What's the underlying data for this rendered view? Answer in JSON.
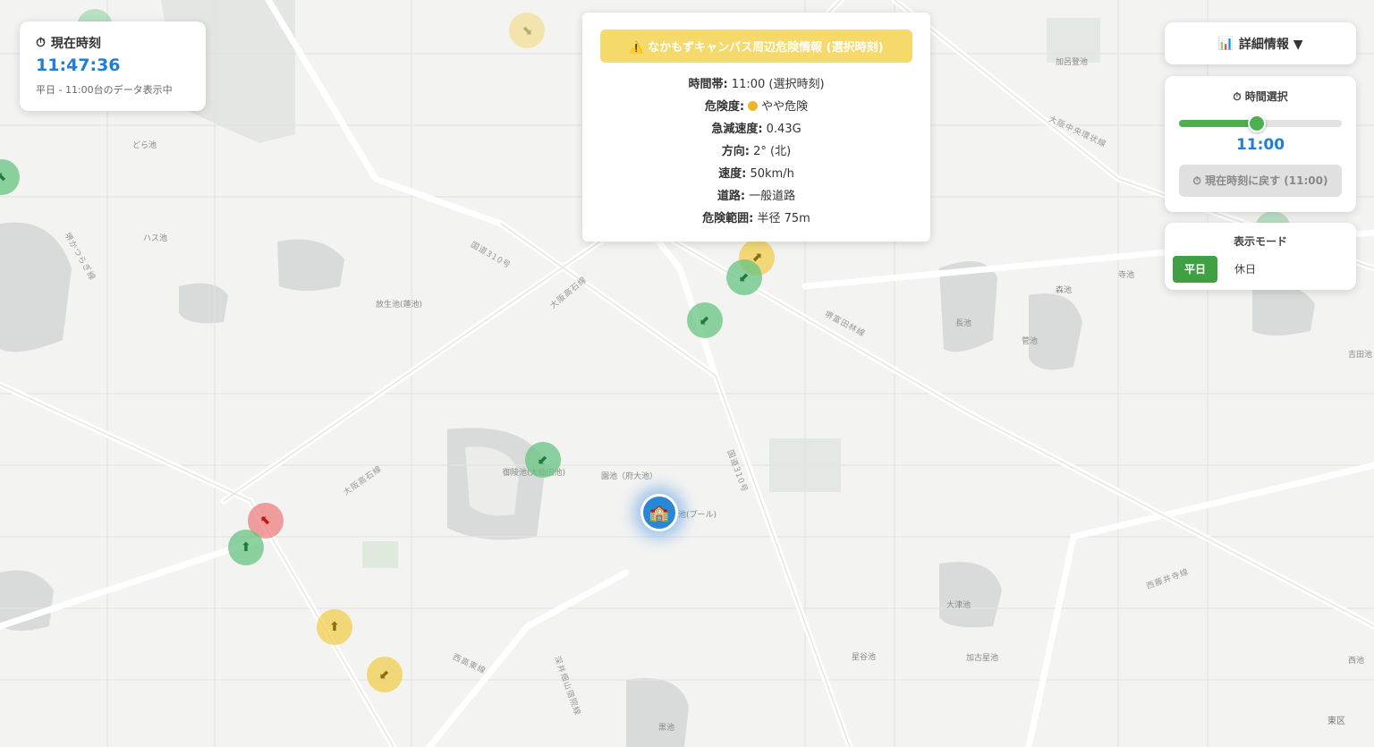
{
  "clock": {
    "icon": "clock-icon",
    "title": "現在時刻",
    "time": "11:47:36",
    "mode_text": "平日 - 11:00台のデータ表示中"
  },
  "popup": {
    "icon": "warning-icon",
    "title": "なかもずキャンパス周辺危険情報 (選択時刻)",
    "rows": [
      {
        "label": "時間帯:",
        "value": "11:00 (選択時刻)"
      },
      {
        "label": "危険度:",
        "value": "やや危険"
      },
      {
        "label": "急減速度:",
        "value": "0.43G"
      },
      {
        "label": "方向:",
        "value": "2° (北)"
      },
      {
        "label": "速度:",
        "value": "50km/h"
      },
      {
        "label": "道路:",
        "value": "一般道路"
      },
      {
        "label": "危険範囲:",
        "value": "半径 75m"
      }
    ],
    "risk_color": "#f0b429"
  },
  "detail": {
    "icon": "bar-chart-icon",
    "label": "詳細情報 ▼"
  },
  "time_select": {
    "icon": "clock-icon",
    "label": "時間選択",
    "value": "11:00",
    "slider_fraction": 0.48,
    "reset_label": "現在時刻に戻す (11:00)"
  },
  "display_mode": {
    "label": "表示モード",
    "options": [
      "平日",
      "休日"
    ],
    "selected": "平日"
  },
  "map_labels": {
    "dora": "どら池",
    "hasu": "ハス池",
    "houshou": "放生池(蓮池)",
    "goryou": "御陵池(大仙田池)",
    "sono": "園池（府大池）",
    "pool": "池(プール)",
    "nagaike": "長池",
    "sugeike": "菅池",
    "moriike": "森池",
    "teraike": "寺池",
    "yoshida": "吉田池",
    "kashiike": "加呂登池",
    "ootsu": "大津池",
    "hoshiya": "星谷池",
    "kako": "加古星池",
    "nishiike": "西池",
    "higashiku": "東区",
    "kuroike": "黒池"
  },
  "road_labels": {
    "kokudo310": "国道310号",
    "osaka_takaishi": "大阪高石線",
    "sakai_tanagi": "堺富田林線",
    "ookan": "大阪中央環状線",
    "nishifujii": "西藤井寺線",
    "nishitokan": "西高東線",
    "sakaikanaoka": "堺かつらぎ線",
    "fukai": "深井畑山宿院線"
  },
  "colors": {
    "safe": "#66c482",
    "caution": "#f2cd4c",
    "danger": "#ec7878",
    "accent": "#1e7fd4",
    "active_mode": "#3ea043"
  }
}
